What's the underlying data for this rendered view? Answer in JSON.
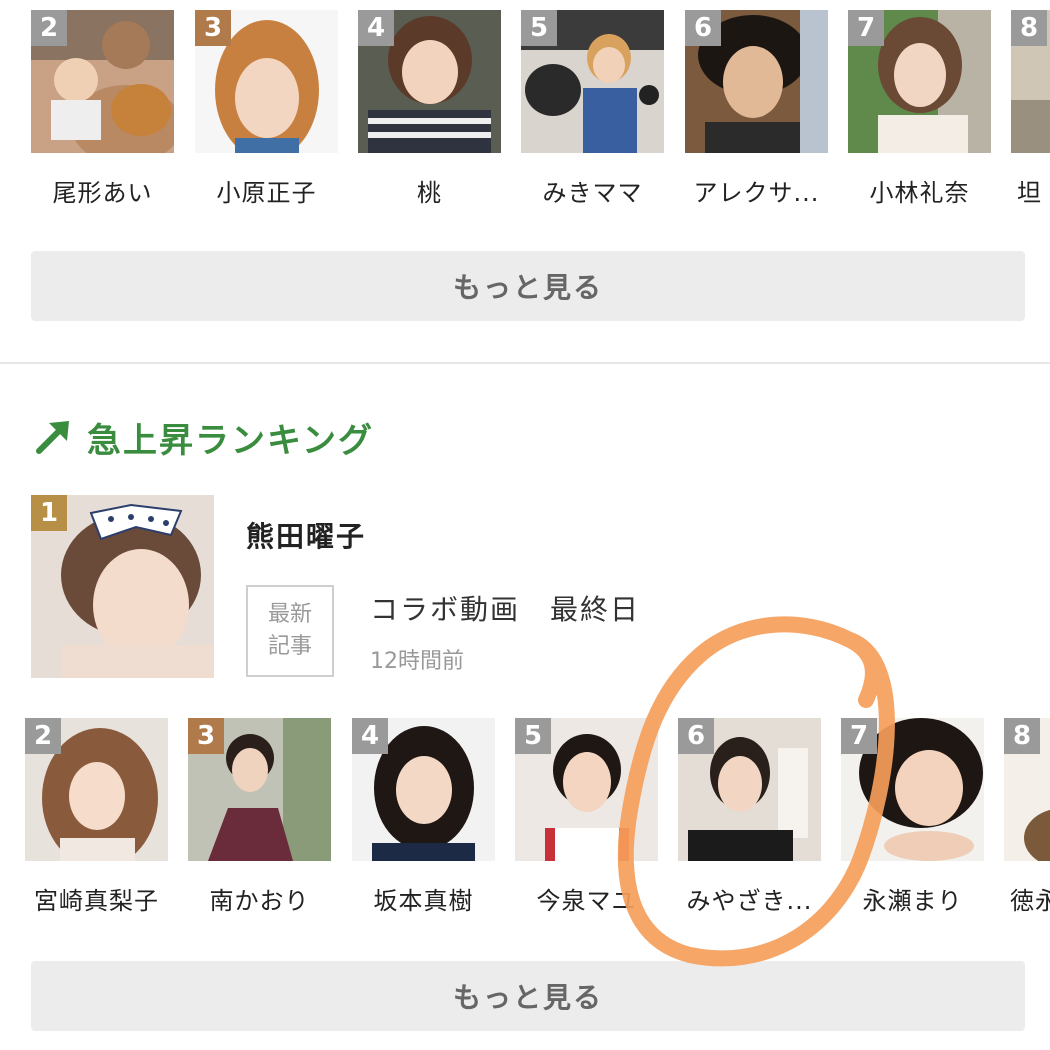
{
  "top_ranking": {
    "items": [
      {
        "rank": "2",
        "name": "尾形あい"
      },
      {
        "rank": "3",
        "name": "小原正子"
      },
      {
        "rank": "4",
        "name": "桃"
      },
      {
        "rank": "5",
        "name": "みきママ"
      },
      {
        "rank": "6",
        "name": "アレクサ..."
      },
      {
        "rank": "7",
        "name": "小林礼奈"
      },
      {
        "rank": "8",
        "name": "坦"
      }
    ],
    "more_label": "もっと見る"
  },
  "rising_ranking": {
    "title": "急上昇ランキング",
    "accent_color": "#3a8c3f",
    "featured": {
      "rank": "1",
      "name": "熊田曜子",
      "badge_line1": "最新",
      "badge_line2": "記事",
      "article_title": "コラボ動画　最終日",
      "article_time": "12時間前"
    },
    "items": [
      {
        "rank": "2",
        "name": "宮崎真梨子"
      },
      {
        "rank": "3",
        "name": "南かおり"
      },
      {
        "rank": "4",
        "name": "坂本真樹"
      },
      {
        "rank": "5",
        "name": "今泉マユ"
      },
      {
        "rank": "6",
        "name": "みやざき..."
      },
      {
        "rank": "7",
        "name": "永瀬まり"
      },
      {
        "rank": "8",
        "name": "徳永"
      }
    ],
    "more_label": "もっと見る"
  },
  "annotation": {
    "color": "#f59e5a"
  }
}
